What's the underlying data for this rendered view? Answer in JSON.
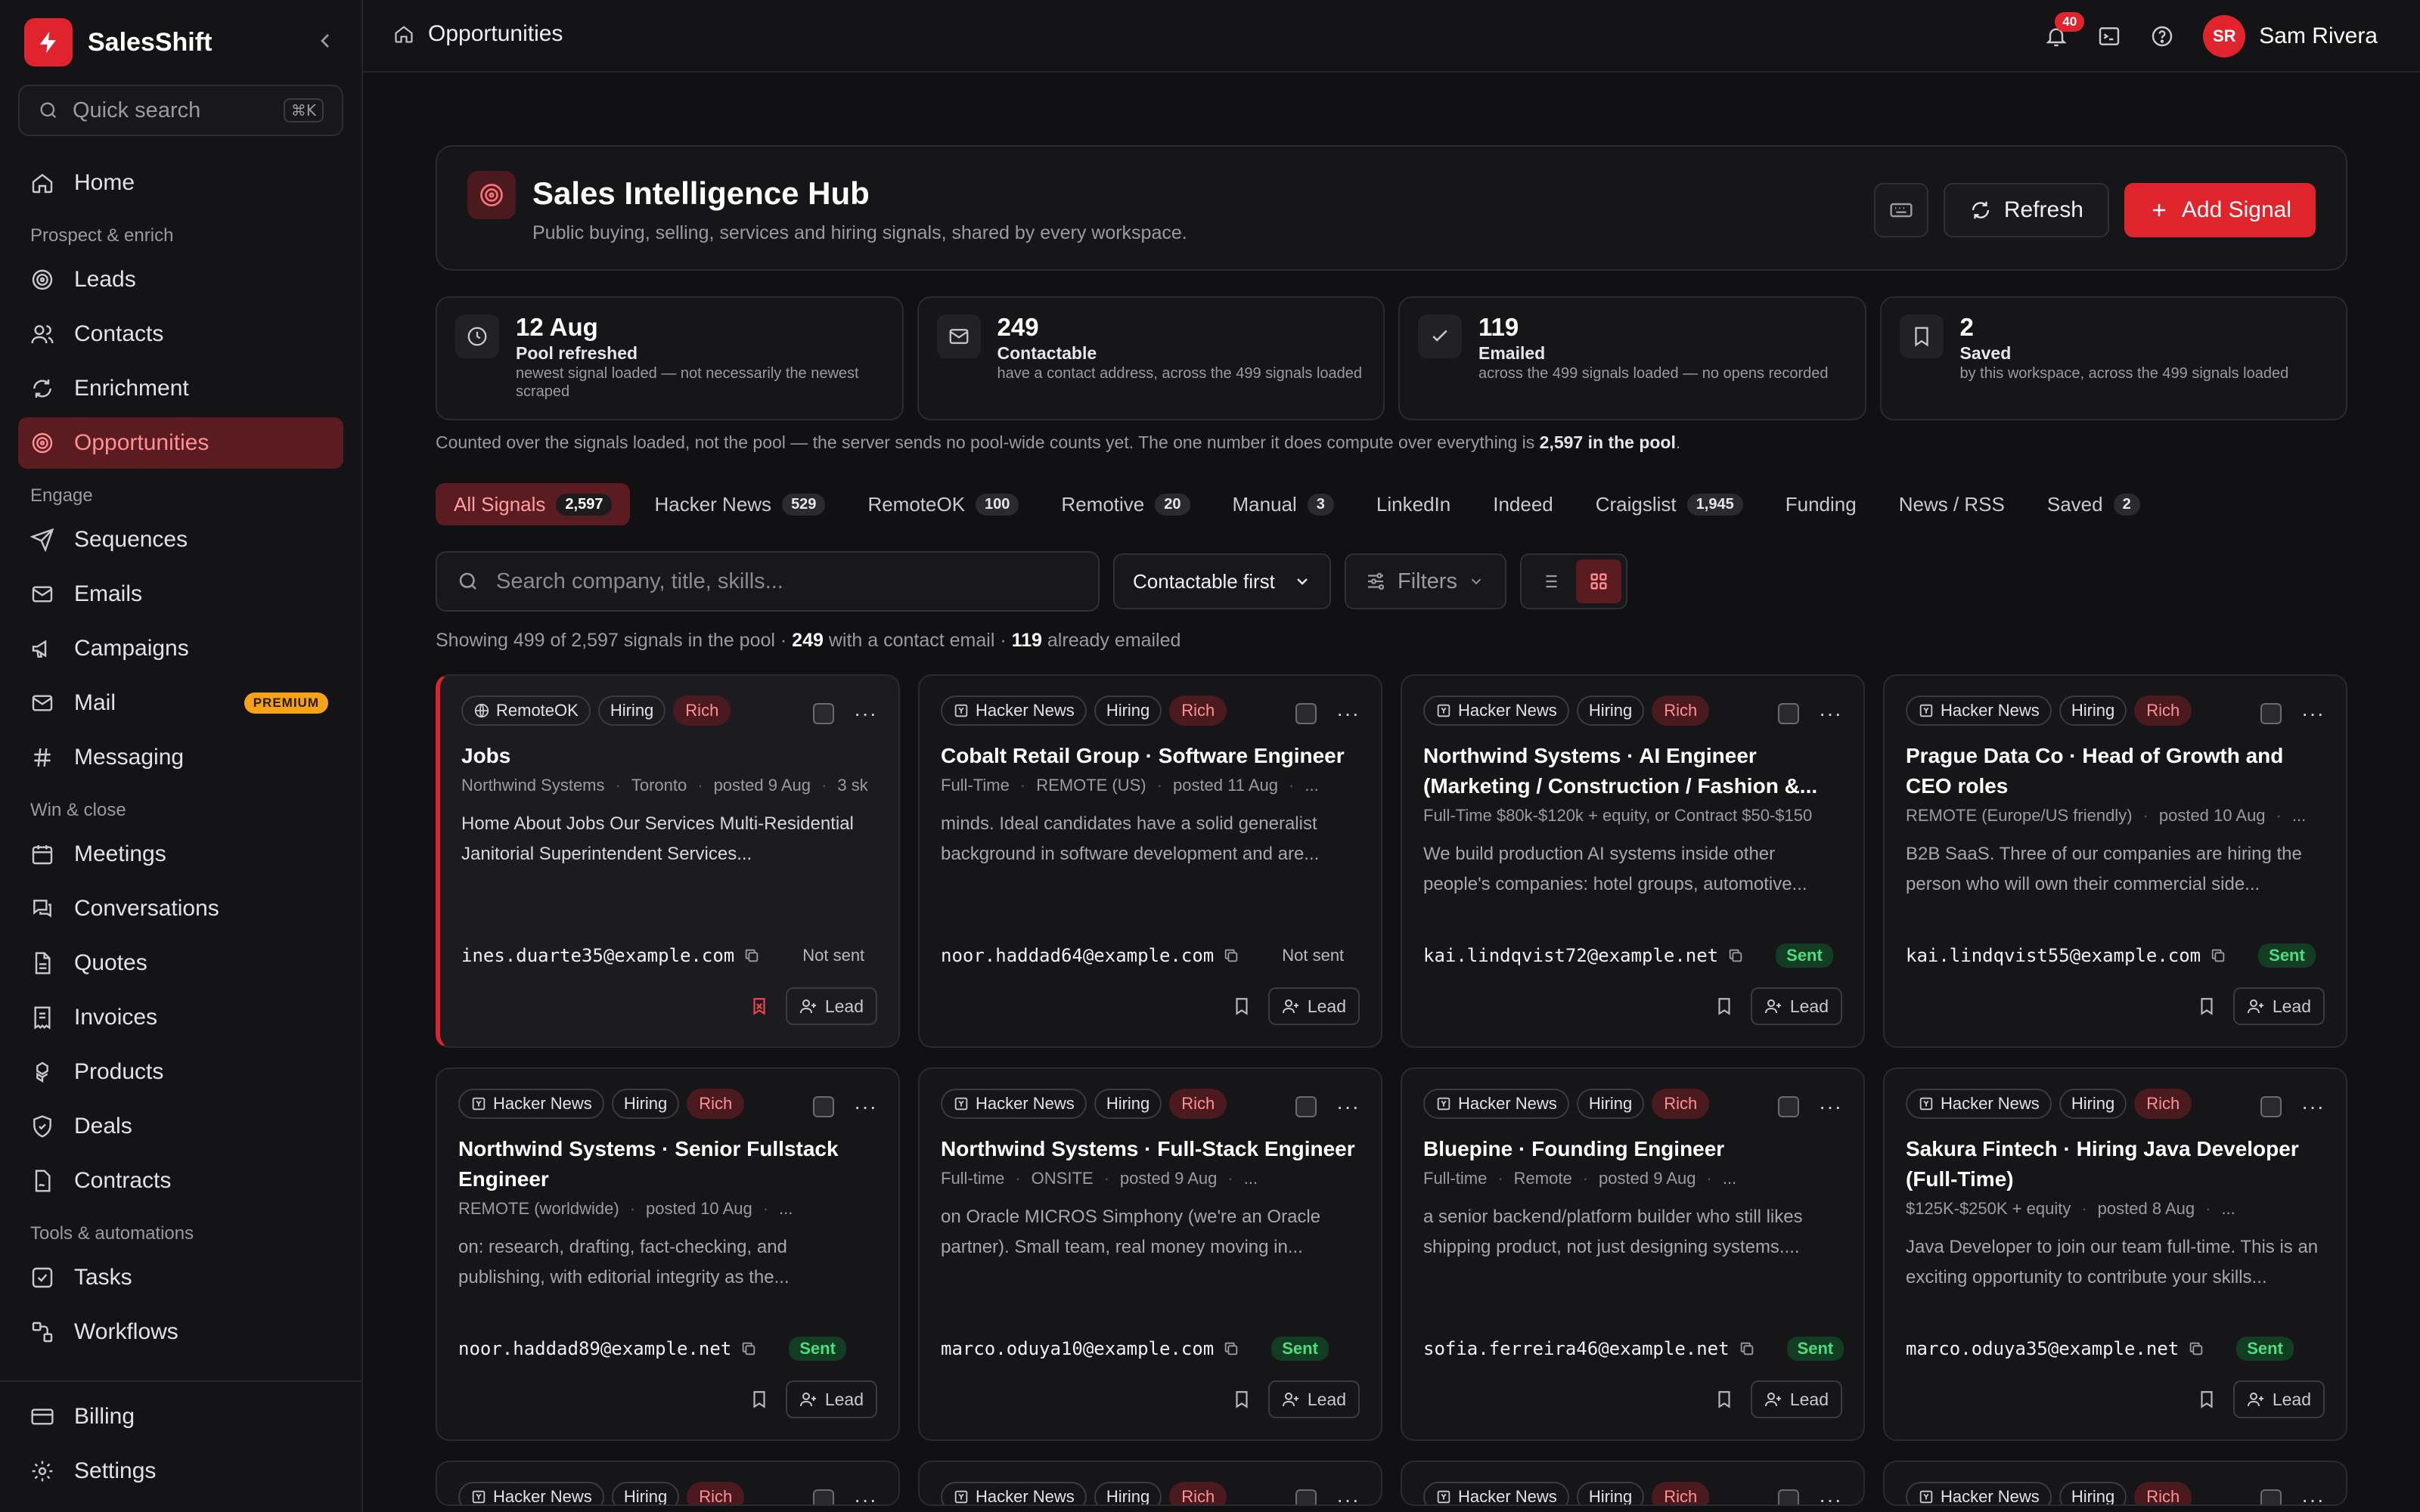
{
  "app": {
    "name": "SalesShift"
  },
  "search": {
    "placeholder": "Quick search",
    "shortcut": "⌘K"
  },
  "nav": {
    "home": "Home",
    "sections": {
      "prospect": "Prospect & enrich",
      "engage": "Engage",
      "win": "Win & close",
      "tools": "Tools & automations"
    },
    "items": {
      "leads": "Leads",
      "contacts": "Contacts",
      "enrichment": "Enrichment",
      "opportunities": "Opportunities",
      "sequences": "Sequences",
      "emails": "Emails",
      "campaigns": "Campaigns",
      "mail": "Mail",
      "messaging": "Messaging",
      "meetings": "Meetings",
      "conversations": "Conversations",
      "quotes": "Quotes",
      "invoices": "Invoices",
      "products": "Products",
      "deals": "Deals",
      "contracts": "Contracts",
      "tasks": "Tasks",
      "workflows": "Workflows",
      "billing": "Billing",
      "settings": "Settings"
    },
    "premium_badge": "PREMIUM",
    "active_color": "#5a1c20"
  },
  "topbar": {
    "breadcrumb": "Opportunities",
    "notifications": "40",
    "user_initials": "SR",
    "user_name": "Sam Rivera"
  },
  "hub": {
    "title": "Sales Intelligence Hub",
    "subtitle": "Public buying, selling, services and hiring signals, shared by every workspace.",
    "refresh": "Refresh",
    "add": "Add Signal"
  },
  "stats": [
    {
      "value": "12 Aug",
      "label": "Pool refreshed",
      "desc": "newest signal loaded — not necessarily the newest scraped",
      "icon": "clock-icon"
    },
    {
      "value": "249",
      "label": "Contactable",
      "desc": "have a contact address, across the 499 signals loaded",
      "icon": "mail-icon"
    },
    {
      "value": "119",
      "label": "Emailed",
      "desc": "across the 499 signals loaded — no opens recorded",
      "icon": "check-icon"
    },
    {
      "value": "2",
      "label": "Saved",
      "desc": "by this workspace, across the 499 signals loaded",
      "icon": "bookmark-icon"
    }
  ],
  "note": {
    "text": "Counted over the signals loaded, not the pool — the server sends no pool-wide counts yet. The one number it does compute over everything is ",
    "bold": "2,597 in the pool",
    "end": "."
  },
  "tabs": [
    {
      "label": "All Signals",
      "count": "2,597"
    },
    {
      "label": "Hacker News",
      "count": "529"
    },
    {
      "label": "RemoteOK",
      "count": "100"
    },
    {
      "label": "Remotive",
      "count": "20"
    },
    {
      "label": "Manual",
      "count": "3"
    },
    {
      "label": "LinkedIn",
      "count": ""
    },
    {
      "label": "Indeed",
      "count": ""
    },
    {
      "label": "Craigslist",
      "count": "1,945"
    },
    {
      "label": "Funding",
      "count": ""
    },
    {
      "label": "News / RSS",
      "count": ""
    },
    {
      "label": "Saved",
      "count": "2"
    }
  ],
  "toolbar": {
    "search_placeholder": "Search company, title, skills...",
    "sort": "Contactable first",
    "filters": "Filters"
  },
  "showing": {
    "a": "Showing 499 of 2,597 signals in the pool",
    "b": "249",
    "c": "with a contact email",
    "d": "119",
    "e": "already emailed"
  },
  "chips": {
    "hiring": "Hiring",
    "rich": "Rich"
  },
  "lead_label": "Lead",
  "cards": [
    {
      "source": "RemoteOK",
      "title": "Jobs",
      "meta": [
        "Northwind Systems",
        "Toronto",
        "posted 9 Aug",
        "3 sk"
      ],
      "desc": "Home About Jobs Our Services Multi-Residential Janitorial Superintendent Services...",
      "email": "ines.duarte35@example.com",
      "status": "Not sent"
    },
    {
      "source": "Hacker News",
      "title": "Cobalt Retail Group · Software Engineer",
      "meta": [
        "Full-Time",
        "REMOTE (US)",
        "posted 11 Aug",
        "..."
      ],
      "desc": "minds. Ideal candidates have a solid generalist background in software development and are...",
      "email": "noor.haddad64@example.com",
      "status": "Not sent"
    },
    {
      "source": "Hacker News",
      "title": "Northwind Systems · AI Engineer (Marketing / Construction / Fashion &...",
      "meta": [
        "Full-Time $80k-$120k + equity, or Contract $50-$150"
      ],
      "desc": "We build production AI systems inside other people's companies: hotel groups, automotive...",
      "email": "kai.lindqvist72@example.net",
      "status": "Sent"
    },
    {
      "source": "Hacker News",
      "title": "Prague Data Co · Head of Growth and CEO roles",
      "meta": [
        "REMOTE (Europe/US friendly)",
        "posted 10 Aug",
        "..."
      ],
      "desc": "B2B SaaS. Three of our companies are hiring the person who will own their commercial side...",
      "email": "kai.lindqvist55@example.com",
      "status": "Sent"
    },
    {
      "source": "Hacker News",
      "title": "Northwind Systems · Senior Fullstack Engineer",
      "meta": [
        "REMOTE (worldwide)",
        "posted 10 Aug",
        "..."
      ],
      "desc": "on: research, drafting, fact-checking, and publishing, with editorial integrity as the...",
      "email": "noor.haddad89@example.net",
      "status": "Sent"
    },
    {
      "source": "Hacker News",
      "title": "Northwind Systems · Full-Stack Engineer",
      "meta": [
        "Full-time",
        "ONSITE",
        "posted 9 Aug",
        "..."
      ],
      "desc": "on Oracle MICROS Simphony (we're an Oracle partner). Small team, real money moving in...",
      "email": "marco.oduya10@example.com",
      "status": "Sent"
    },
    {
      "source": "Hacker News",
      "title": "Bluepine · Founding Engineer",
      "meta": [
        "Full-time",
        "Remote",
        "posted 9 Aug",
        "..."
      ],
      "desc": "a senior backend/platform builder who still likes shipping product, not just designing systems....",
      "email": "sofia.ferreira46@example.net",
      "status": "Sent"
    },
    {
      "source": "Hacker News",
      "title": "Sakura Fintech · Hiring Java Developer (Full-Time)",
      "meta": [
        "$125K-$250K + equity",
        "posted 8 Aug",
        "..."
      ],
      "desc": "Java Developer to join our team full-time. This is an exciting opportunity to contribute your skills...",
      "email": "marco.oduya35@example.net",
      "status": "Sent"
    }
  ],
  "partial_cards": [
    {
      "source": "Hacker News"
    },
    {
      "source": "Hacker News"
    },
    {
      "source": "Hacker News"
    },
    {
      "source": "Hacker News"
    }
  ]
}
